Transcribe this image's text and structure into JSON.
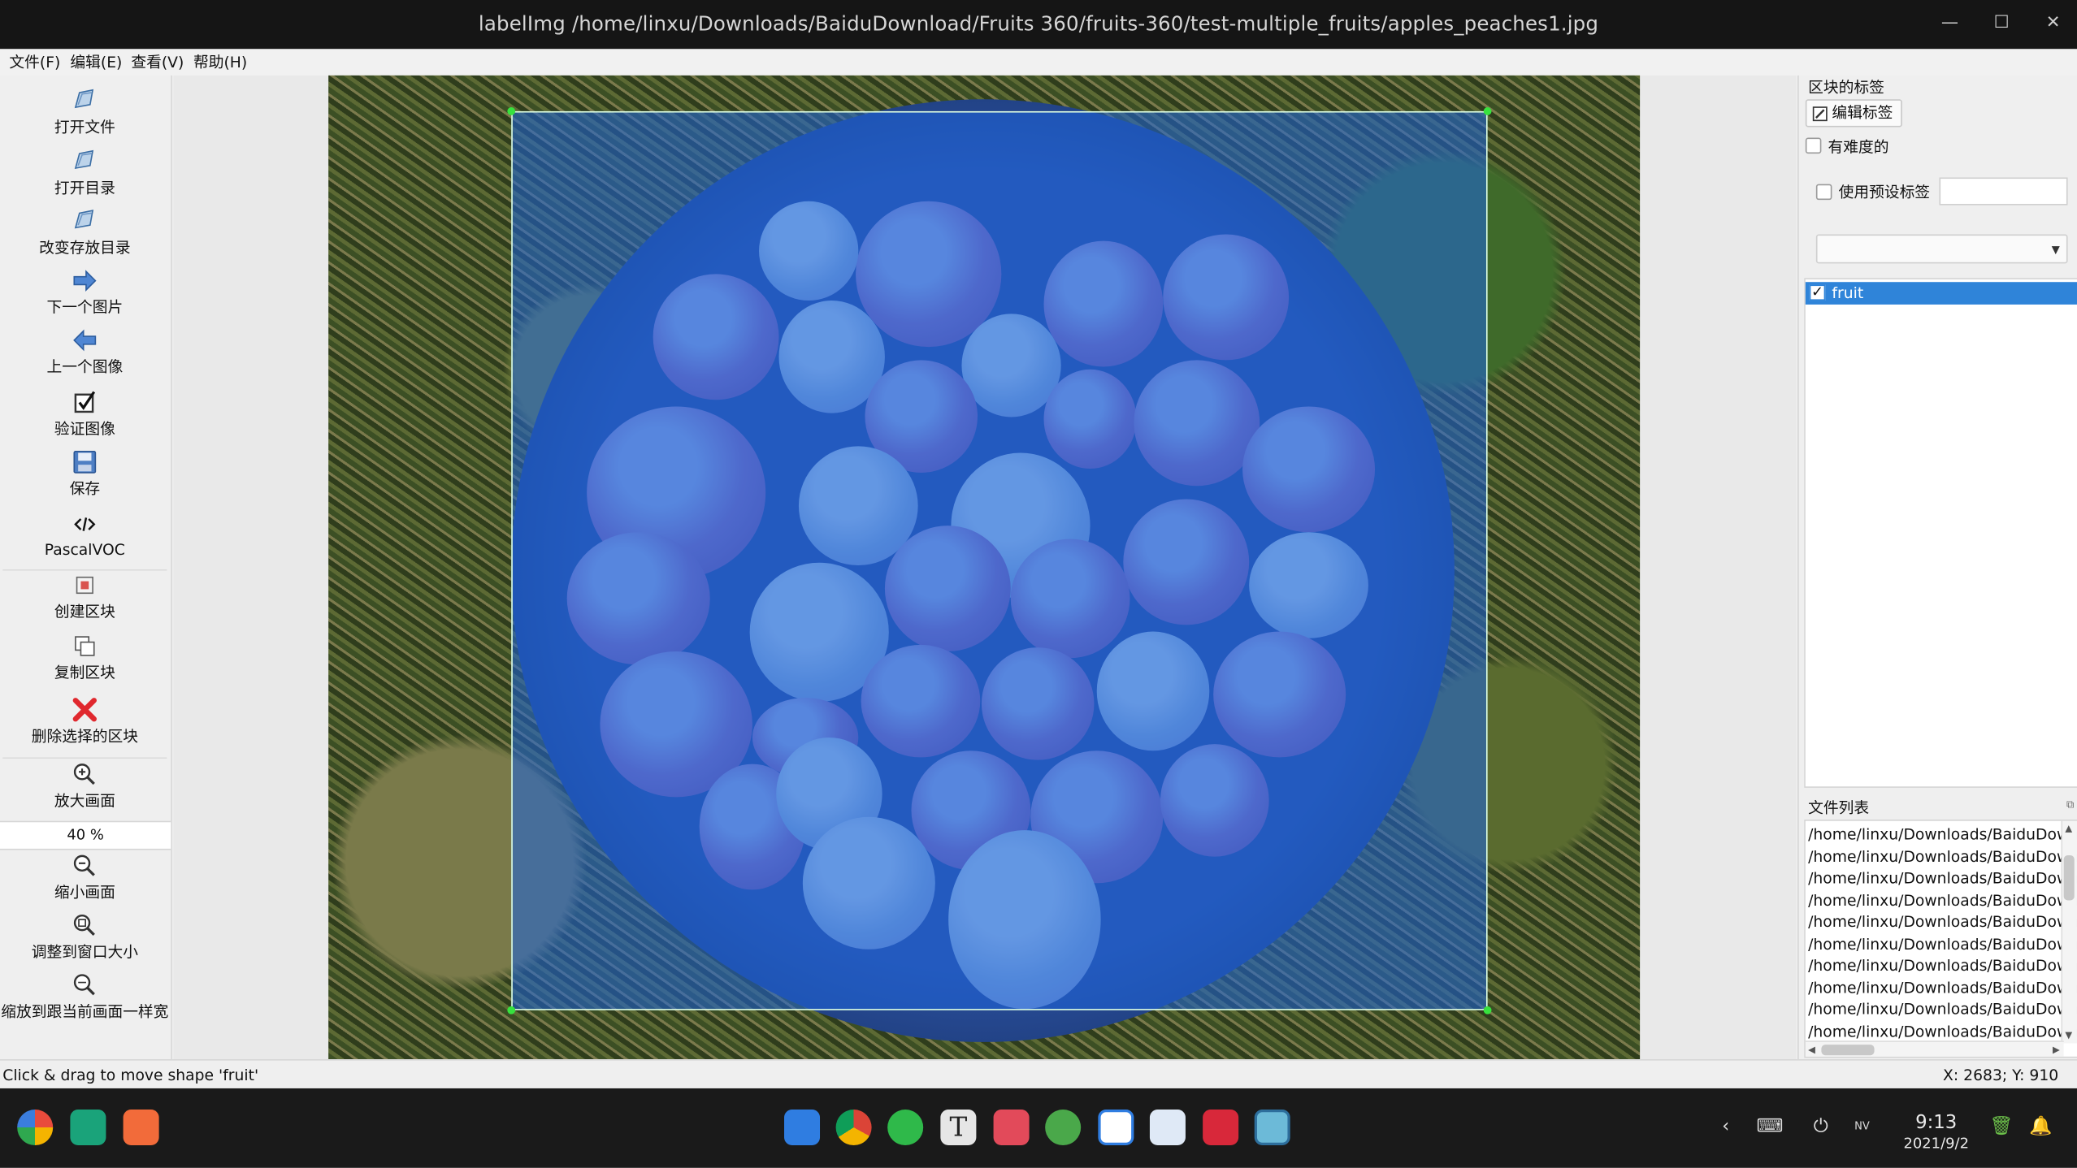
{
  "window": {
    "title": "labelImg /home/linxu/Downloads/BaiduDownload/Fruits 360/fruits-360/test-multiple_fruits/apples_peaches1.jpg",
    "minimize": "—",
    "maximize": "☐",
    "close": "✕"
  },
  "menu": [
    "文件(F)",
    "编辑(E)",
    "查看(V)",
    "帮助(H)"
  ],
  "toolbar": {
    "open_file": "打开文件",
    "open_dir": "打开目录",
    "change_save_dir": "改变存放目录",
    "next_image": "下一个图片",
    "prev_image": "上一个图像",
    "verify_image": "验证图像",
    "save": "保存",
    "format": "PascalVOC",
    "create_box": "创建区块",
    "duplicate_box": "复制区块",
    "delete_box": "删除选择的区块",
    "zoom_in": "放大画面",
    "zoom_value": "40 %",
    "zoom_out": "缩小画面",
    "fit_window": "调整到窗口大小",
    "fit_width": "缩放到跟当前画面一样宽"
  },
  "right_panel": {
    "box_labels_title": "区块的标签",
    "edit_label_button": "编辑标签",
    "difficult_label": "有难度的",
    "use_default_label": "使用预设标签",
    "default_label_value": "",
    "labels": [
      {
        "name": "fruit",
        "checked": true
      }
    ],
    "file_list_title": "文件列表",
    "files": [
      "/home/linxu/Downloads/BaiduDown",
      "/home/linxu/Downloads/BaiduDown",
      "/home/linxu/Downloads/BaiduDown",
      "/home/linxu/Downloads/BaiduDown",
      "/home/linxu/Downloads/BaiduDown",
      "/home/linxu/Downloads/BaiduDown",
      "/home/linxu/Downloads/BaiduDown",
      "/home/linxu/Downloads/BaiduDown",
      "/home/linxu/Downloads/BaiduDown",
      "/home/linxu/Downloads/BaiduDown"
    ]
  },
  "status": {
    "message": "Click & drag to move shape 'fruit'",
    "coords": "X: 2683; Y: 910"
  },
  "taskbar": {
    "time": "9:13",
    "date": "2021/9/2",
    "apps": [
      "launcher-icon",
      "file-manager-icon",
      "app-store-icon",
      "store-icon",
      "chrome-icon",
      "wechat-icon",
      "typora-icon",
      "reader-icon",
      "evernote-icon",
      "messenger-icon",
      "notes-icon",
      "terminal-icon",
      "labelimg-icon"
    ]
  },
  "colors": {
    "bbox_fill": "#1e64dc",
    "bbox_handle": "#37e23e",
    "selection": "#2f84d9"
  }
}
